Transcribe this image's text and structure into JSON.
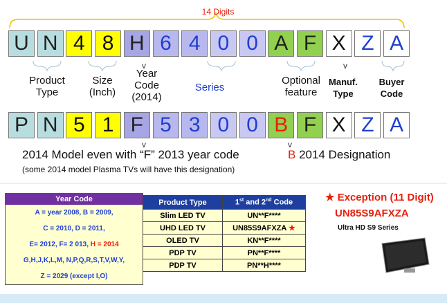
{
  "top_label": "14 Digits",
  "row1": [
    {
      "ch": "U",
      "cls": "c-teal"
    },
    {
      "ch": "N",
      "cls": "c-teal"
    },
    {
      "ch": "4",
      "cls": "c-yellow"
    },
    {
      "ch": "8",
      "cls": "c-yellow"
    },
    {
      "ch": "H",
      "cls": "c-purple"
    },
    {
      "ch": "6",
      "cls": "c-lav"
    },
    {
      "ch": "4",
      "cls": "c-lav"
    },
    {
      "ch": "0",
      "cls": "c-lav2"
    },
    {
      "ch": "0",
      "cls": "c-lav2"
    },
    {
      "ch": "A",
      "cls": "c-green"
    },
    {
      "ch": "F",
      "cls": "c-green"
    },
    {
      "ch": "X",
      "cls": "c-white"
    },
    {
      "ch": "Z",
      "cls": "c-white-blue"
    },
    {
      "ch": "A",
      "cls": "c-white-blue"
    }
  ],
  "row2": [
    {
      "ch": "P",
      "cls": "c-teal"
    },
    {
      "ch": "N",
      "cls": "c-teal"
    },
    {
      "ch": "5",
      "cls": "c-yellow"
    },
    {
      "ch": "1",
      "cls": "c-yellow"
    },
    {
      "ch": "F",
      "cls": "c-purple"
    },
    {
      "ch": "5",
      "cls": "c-lav"
    },
    {
      "ch": "3",
      "cls": "c-lav"
    },
    {
      "ch": "0",
      "cls": "c-lav2"
    },
    {
      "ch": "0",
      "cls": "c-lav2"
    },
    {
      "ch": "B",
      "cls": "c-green-red"
    },
    {
      "ch": "F",
      "cls": "c-green"
    },
    {
      "ch": "X",
      "cls": "c-white"
    },
    {
      "ch": "Z",
      "cls": "c-white-blue"
    },
    {
      "ch": "A",
      "cls": "c-white-blue"
    }
  ],
  "labels": {
    "product_type": "Product Type",
    "size": "Size (Inch)",
    "year_code": "Year Code (2014)",
    "series": "Series",
    "optional": "Optional feature",
    "manuf": "Manuf. Type",
    "buyer": "Buyer Code"
  },
  "note_main": "2014 Model even with “F” 2013 year code",
  "note_sub": "(some 2014 model Plasma TVs will have this designation)",
  "b_letter": "B",
  "b_text": " 2014 Designation",
  "year_table": {
    "header": "Year Code",
    "lines": [
      "A = year 2008, B = 2009,",
      "C = 2010, D = 2011,",
      "E= 2012,  F= 2 013,",
      "G,H,J,K,L,M, N,P,Q,R,S,T,V,W,Y,",
      "Z = 2029 (except I,O)"
    ],
    "h_red": "H = 2014"
  },
  "type_table": {
    "col1": "Product Type",
    "col2_pre": "1",
    "col2_sup": "st",
    "col2_mid": " and 2",
    "col2_sup2": "nd",
    "col2_post": " Code",
    "rows": [
      {
        "type": "Slim LED TV",
        "code": "UN**F****"
      },
      {
        "type": "UHD LED TV",
        "code": "UN85S9AFXZA"
      },
      {
        "type": "OLED TV",
        "code": "KN**F****"
      },
      {
        "type": "PDP TV",
        "code": "PN**F****"
      },
      {
        "type": "PDP TV",
        "code": "PN**H****"
      }
    ]
  },
  "exception_title": "★ Exception (11 Digit)",
  "exception_code": "UN85S9AFXZA",
  "exception_series": "Ultra HD S9 Series",
  "colors": {
    "accent_red": "#e8200c",
    "blue": "#1f3fd0",
    "header_purple": "#7030a0",
    "table_blue": "#1f3f9f",
    "bracket": "#f0c000"
  }
}
